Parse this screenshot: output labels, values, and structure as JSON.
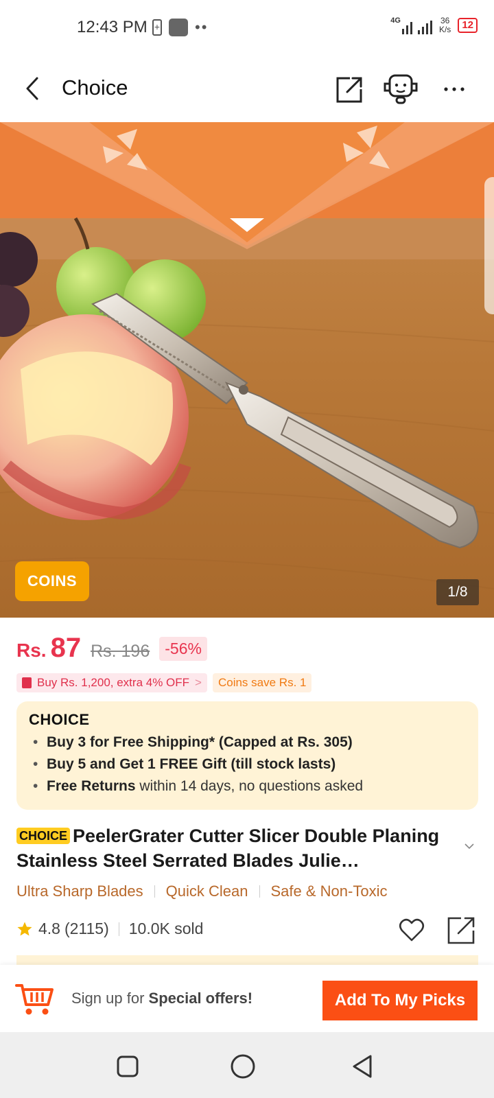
{
  "status_bar": {
    "time": "12:43 PM",
    "network": "4G",
    "speed_value": "36",
    "speed_unit": "K/s",
    "battery": "12"
  },
  "header": {
    "title": "Choice"
  },
  "gallery": {
    "coins_badge": "COINS",
    "counter": "1/8"
  },
  "price": {
    "currency": "Rs.",
    "amount": "87",
    "original": "Rs. 196",
    "discount": "-56%"
  },
  "promos": {
    "bundle": "Buy Rs. 1,200, extra 4% OFF",
    "bundle_chevron": ">",
    "coins": "Coins save Rs. 1"
  },
  "choice_card": {
    "logo": "CHOICE",
    "benefits": [
      {
        "bold": "Buy 3 for  Free Shipping* (Capped at Rs. 305)",
        "rest": ""
      },
      {
        "bold": "Buy 5 and Get 1 FREE Gift (till stock lasts)",
        "rest": ""
      },
      {
        "bold": "Free Returns",
        "rest": " within 14 days, no questions asked"
      }
    ]
  },
  "product": {
    "tag": "CHOICE",
    "title": "PeelerGrater Cutter Slicer Double Planing Stainless Steel Serrated Blades Julie…",
    "features": [
      "Ultra Sharp Blades",
      "Quick Clean",
      "Safe & Non-Toxic"
    ],
    "rating": "4.8",
    "reviews": "(2115)",
    "sold": "10.0K sold"
  },
  "bottom_bar": {
    "signup_prefix": "Sign up for ",
    "signup_bold": "Special offers!",
    "add_button": "Add To My Picks"
  },
  "colors": {
    "price_red": "#e8344e",
    "accent_orange": "#fb4f14",
    "choice_yellow": "#ffcc21",
    "card_bg": "#fff3d6",
    "coins_badge": "#f5a200"
  }
}
